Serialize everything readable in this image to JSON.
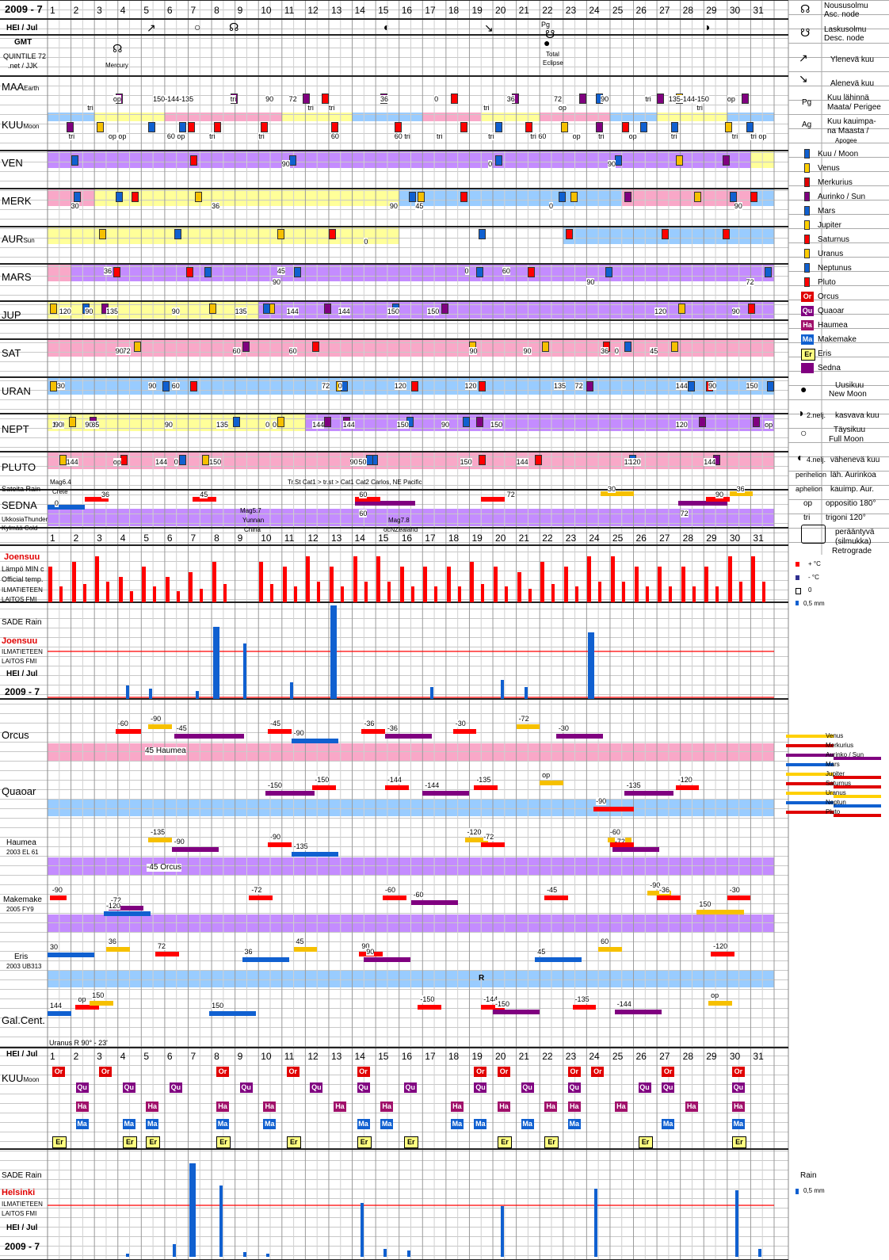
{
  "header": {
    "year_month": "2009 - 7",
    "month_label": "HEI / Jul",
    "gmt": "GMT",
    "credit1": "QUINTILE 72",
    "credit2": ".net / JJK"
  },
  "days": [
    "1",
    "2",
    "3",
    "4",
    "5",
    "6",
    "7",
    "8",
    "9",
    "10",
    "11",
    "12",
    "13",
    "14",
    "15",
    "16",
    "17",
    "18",
    "19",
    "20",
    "21",
    "22",
    "23",
    "24",
    "25",
    "26",
    "27",
    "28",
    "29",
    "30",
    "31"
  ],
  "rows": {
    "maa": "MAA",
    "maa_sub": "Earth",
    "kuu": "KUU",
    "kuu_sub": "Moon",
    "ven": "VEN",
    "merk": "MERK",
    "aur": "AUR",
    "aur_sub": "Sun",
    "mars": "MARS",
    "jup": "JUP",
    "sat": "SAT",
    "uran": "URAN",
    "nept": "NEPT",
    "pluto": "PLUTO",
    "sateita": "Sateita Rain",
    "sedna": "SEDNA",
    "ukkosia": "UkkosiaThunder",
    "kylmaa": "Kylmää Cold"
  },
  "events": {
    "mercury": "Mercury",
    "total": "Total",
    "eclipse": "Eclipse",
    "pg": "Pg",
    "crete": "Crete",
    "mag64": "Mag6.4",
    "mag57": "Mag5.7",
    "yunnan": "Yunnan",
    "china": "China",
    "mag78": "Mag7.8",
    "nzealand": "ocNZealand",
    "storms": "Tr.St  Cat1  >   tr.st   >  Cat1  Cat2    Carlos,  NE Pacific"
  },
  "weather": {
    "joensuu": "Joensuu",
    "lampo": "Lämpö MIN c",
    "official": "Official temp.",
    "ilmatieteen": "ILMATIETEEN",
    "laitos": "LAITOS  FMI",
    "sade_rain": "SADE Rain",
    "helsinki": "Helsinki",
    "temp_min": [
      7,
      8,
      9,
      5,
      7,
      5,
      6,
      8,
      0,
      8,
      7,
      9,
      7,
      9,
      9,
      7,
      7,
      7,
      8,
      7,
      6,
      8,
      7,
      9,
      9,
      7,
      7,
      7,
      7,
      9,
      9
    ],
    "rain_joensuu": [
      0,
      0,
      0,
      1.2,
      0.9,
      0,
      0.7,
      6.5,
      5,
      0,
      1.5,
      0,
      8.5,
      0,
      0,
      0,
      1.1,
      0,
      0,
      1.7,
      1.1,
      0,
      0,
      6,
      0,
      0,
      0,
      0,
      0,
      0,
      0
    ],
    "rain_helsinki": [
      0,
      0,
      0,
      0.2,
      0,
      0.8,
      6.5,
      4.5,
      0.3,
      0.2,
      0,
      0,
      0,
      3.4,
      0.5,
      0.4,
      0,
      0,
      0,
      3.2,
      0,
      0,
      0,
      4.3,
      0,
      0,
      0,
      0,
      0,
      4.2,
      0.5
    ]
  },
  "minor": {
    "orcus": "Orcus",
    "quaoar": "Quaoar",
    "haumea": "Haumea",
    "haumea_sub": "2003 EL 61",
    "makemake": "Makemake",
    "makemake_sub": "2005 FY9",
    "eris": "Eris",
    "eris_sub": "2003 UB313",
    "galcent": "Gal.Cent.",
    "uranus_r": "Uranus   R   90° - 23'",
    "haumea45": "45 Haumea",
    "orcus45": "-45 Orcus",
    "r": "R"
  },
  "legend": {
    "asc": "Nousu­solmu",
    "asc2": "Asc. node",
    "desc": "Laskusolmu",
    "desc2": "Desc. node",
    "rising": "Ylenevä kuu",
    "falling": "Alenevä kuu",
    "perigee1": "Kuu lähinnä",
    "perigee2": "Maata/ Perigee",
    "pg": "Pg",
    "ag": "Ag",
    "apogee1": "Kuu kauimpa-",
    "apogee2": "na Maasta /",
    "apogee3": "Apogee",
    "planets": [
      "Kuu / Moon",
      "Venus",
      "Merkurius",
      "Aurinko / Sun",
      "Mars",
      "Jupiter",
      "Saturnus",
      "Uranus",
      "Neptunus",
      "Pluto",
      "Orcus",
      "Quaoar",
      "Haumea",
      "Makemake",
      "Eris",
      "Sedna"
    ],
    "newmoon1": "Uusikuu",
    "newmoon2": "New Moon",
    "q2": "2.nelj.",
    "waxing": "kasvava kuu",
    "full1": "Täysikuu",
    "full2": "Full Moon",
    "q4": "4.nelj.",
    "waning": "vähenevä kuu",
    "perihelion": "perihelion",
    "peri_text": "läh. Aurinkoa",
    "aphelion": "aphelion",
    "aph_text": "kauimp. Aur.",
    "op": "op",
    "op_text": "oppositio 180°",
    "tri": "tri",
    "tri_text": "trigoni 120°",
    "retro1": "peräänty­vä",
    "retro2": "(silmukka)",
    "retro3": "Retrograde",
    "temp_plus": "+ °C",
    "temp_minus": "-  °C",
    "zero": "0",
    "mm": "0,5 mm",
    "rain": "Rain",
    "lines": [
      "Venus",
      "Merkurius",
      "Aurinko / Sun",
      "Mars",
      "Jupiter",
      "Saturnus",
      "Uranus",
      "Neptun",
      "Pluto"
    ]
  },
  "colors": {
    "pink": "#f9a8c8",
    "purple": "#c48cff",
    "yellow": "#ffff99",
    "blue": "#99ccff",
    "red": "#ff0000",
    "blueMark": "#1060d0",
    "orange": "#f6c000",
    "violet": "#800080"
  }
}
